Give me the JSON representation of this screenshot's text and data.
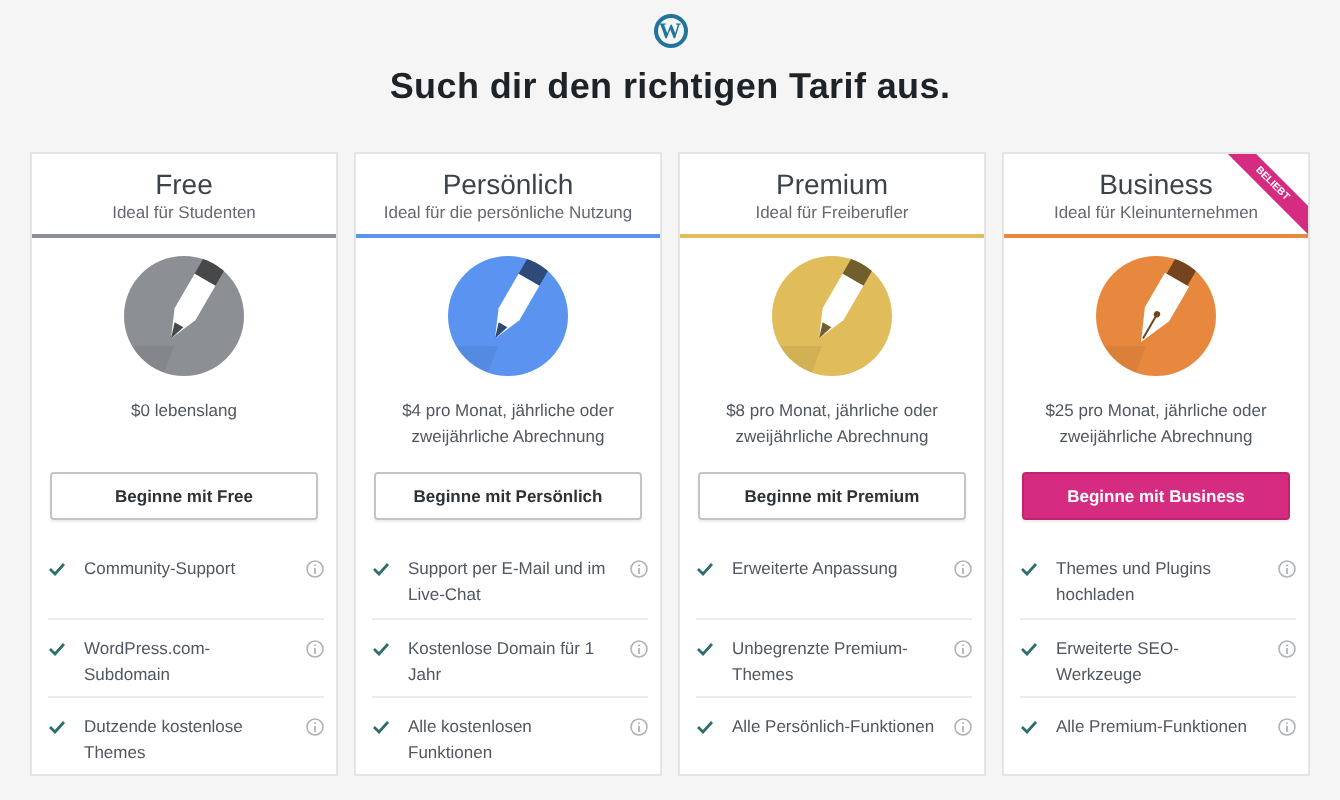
{
  "logo": "W",
  "heading": "Such dir den richtigen Tarif aus.",
  "plans": [
    {
      "name": "Free",
      "tagline": "Ideal für Studenten",
      "color": "#8c8f94",
      "kind": "pencil",
      "price": "$0 lebenslang",
      "button": "Beginne mit Free",
      "highlighted": false,
      "features": [
        "Community-Support",
        "WordPress.com-Subdomain",
        "Dutzende kostenlose Themes"
      ]
    },
    {
      "name": "Persönlich",
      "tagline": "Ideal für die persönliche Nutzung",
      "color": "#5b93f0",
      "kind": "pencil",
      "price": "$4 pro Monat, jährliche oder zweijährliche Abrechnung",
      "button": "Beginne mit Persönlich",
      "highlighted": false,
      "features": [
        "Support per E-Mail und im Live-Chat",
        "Kostenlose Domain für 1 Jahr",
        "Alle kostenlosen Funktionen"
      ]
    },
    {
      "name": "Premium",
      "tagline": "Ideal für Freiberufler",
      "color": "#e0bc5a",
      "kind": "pencil",
      "price": "$8 pro Monat, jährliche oder zweijährliche Abrechnung",
      "button": "Beginne mit Premium",
      "highlighted": false,
      "features": [
        "Erweiterte Anpassung",
        "Unbegrenzte Premium-Themes",
        "Alle Persönlich-Funktionen"
      ]
    },
    {
      "name": "Business",
      "tagline": "Ideal für Kleinunternehmen",
      "color": "#e8883e",
      "kind": "pen",
      "price": "$25 pro Monat, jährliche oder zweijährliche Abrechnung",
      "button": "Beginne mit Business",
      "highlighted": true,
      "badge": "BELIEBT",
      "features": [
        "Themes und Plugins hochladen",
        "Erweiterte SEO-Werkzeuge",
        "Alle Premium-Funktionen"
      ]
    }
  ]
}
